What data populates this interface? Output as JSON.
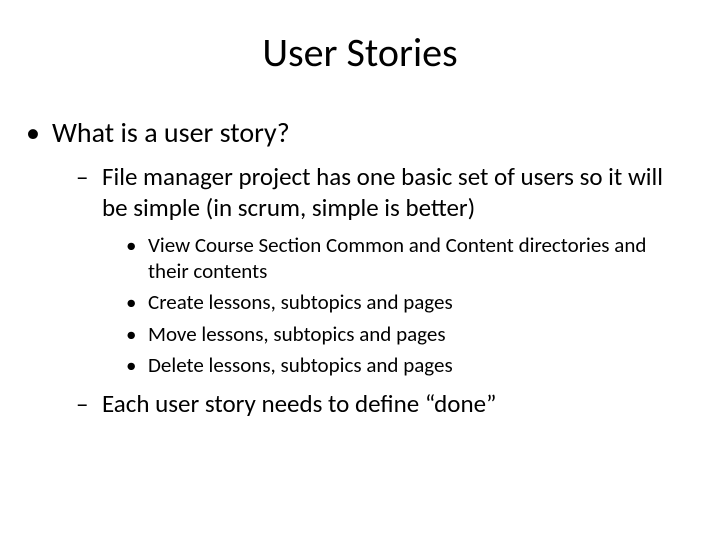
{
  "title": "User Stories",
  "bullets": {
    "l1_0": "What is a user story?",
    "l2_0": "File manager project has one basic set of users so it will be simple (in scrum, simple is better)",
    "l3_0": "View Course Section Common and Content directories and their contents",
    "l3_1": "Create lessons, subtopics and pages",
    "l3_2": "Move lessons, subtopics and pages",
    "l3_3": "Delete lessons, subtopics and pages",
    "l2_1": "Each user story needs to define “done”"
  }
}
